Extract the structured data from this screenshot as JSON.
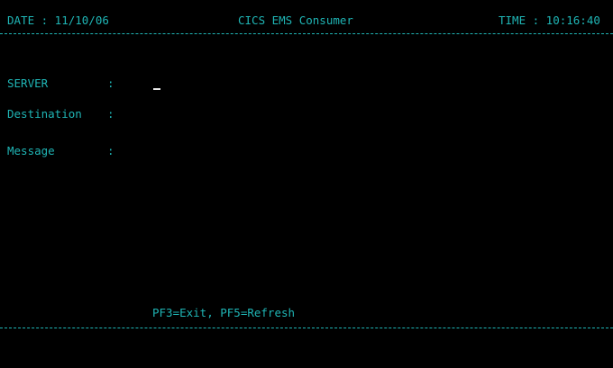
{
  "header": {
    "date_label": "DATE : 11/10/06",
    "title": "CICS EMS Consumer",
    "time_label": "TIME : 10:16:40"
  },
  "form": {
    "server_label": "SERVER",
    "server_sep": ":",
    "destination_label": "Destination",
    "destination_sep": ":",
    "message_label": "Message",
    "message_sep": ":",
    "server_value": "",
    "destination_value": "",
    "message_value": ""
  },
  "footer": {
    "keys": "PF3=Exit, PF5=Refresh"
  },
  "colors": {
    "text": "#1fb5b5",
    "background": "#000000",
    "cursor": "#e8e8e8"
  }
}
